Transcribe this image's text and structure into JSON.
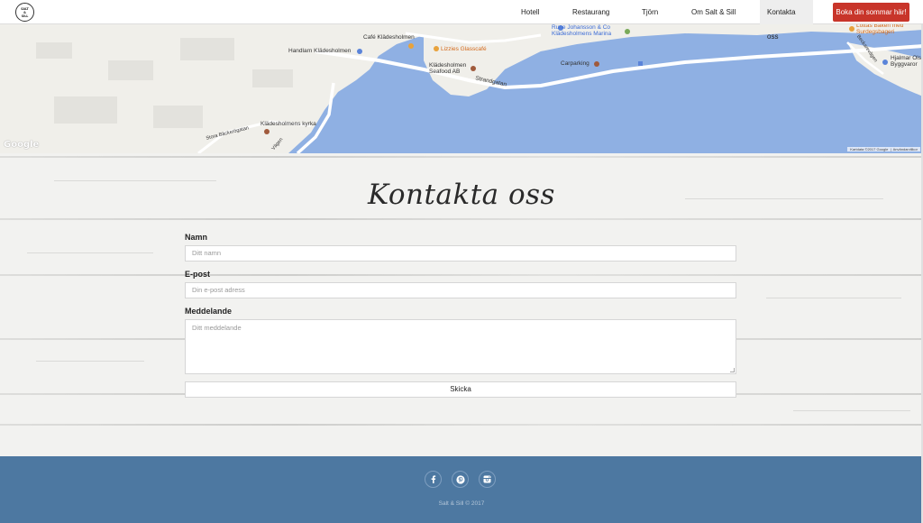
{
  "header": {
    "logo_lines": [
      "SALT",
      "&",
      "SILL"
    ],
    "nav": [
      {
        "label": "Hotell"
      },
      {
        "label": "Restaurang"
      },
      {
        "label": "Tjörn"
      },
      {
        "label": "Om Salt & Sill"
      },
      {
        "label": "Kontakta oss",
        "active": true
      }
    ],
    "cta_label": "Boka din sommar här!",
    "cta_color": "#c8352a"
  },
  "map": {
    "labels": [
      "Café Klädesholmen",
      "Handlarn Klädesholmen",
      "Lizzies Glasscafé",
      "Rune Johansson & Co Klädesholmens Marina",
      "Klädesholmen Seafood AB",
      "Carparking",
      "Strandgatan",
      "Klädesholmens kyrka",
      "Stora Bäckerögatan",
      "Vägen",
      "Lottas Bakeri med Surdegsbageri",
      "Hjalmar Ols Byggvaror",
      "Beckarevägen"
    ],
    "google_logo": "Google",
    "attribution": "Kartdata ©2017 Google",
    "terms": "Användarvillkor",
    "water_color": "#8fb0e3"
  },
  "contact": {
    "title": "Kontakta oss",
    "name_label": "Namn",
    "name_placeholder": "Ditt namn",
    "email_label": "E-post",
    "email_placeholder": "Din e-post adress",
    "message_label": "Meddelande",
    "message_placeholder": "Ditt meddelande",
    "submit_label": "Skicka"
  },
  "footer": {
    "social_icons": [
      "facebook-icon",
      "pinterest-icon",
      "instagram-icon"
    ],
    "copyright": "Salt & Sill © 2017",
    "background_color": "#4d78a1"
  }
}
